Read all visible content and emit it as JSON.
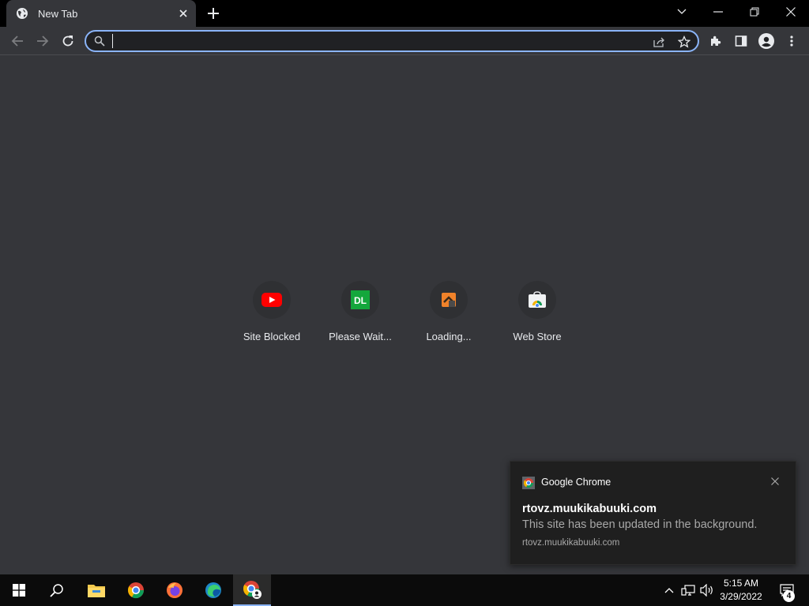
{
  "window": {
    "tab": {
      "title": "New Tab",
      "favicon": "globe-icon"
    },
    "controls": {
      "tab_search": "chevron-down-icon",
      "minimize": "minimize-icon",
      "restore": "restore-icon",
      "close": "close-icon"
    }
  },
  "toolbar": {
    "back": "arrow-left-icon",
    "forward": "arrow-right-icon",
    "reload": "reload-icon",
    "omnibox": {
      "value": "",
      "placeholder": ""
    },
    "share": "share-icon",
    "bookmark": "star-icon",
    "extensions": "puzzle-icon",
    "side_panel": "side-panel-icon",
    "profile": "profile-icon",
    "menu": "kebab-menu-icon"
  },
  "shortcuts": [
    {
      "label": "Site Blocked",
      "icon": "youtube-icon"
    },
    {
      "label": "Please Wait...",
      "icon": "dl-icon",
      "icon_text": "DL"
    },
    {
      "label": "Loading...",
      "icon": "orange-hammer-icon"
    },
    {
      "label": "Web Store",
      "icon": "chrome-web-store-icon"
    }
  ],
  "notification": {
    "app": "Google Chrome",
    "title": "rtovz.muukikabuuki.com",
    "body": "This site has been updated in the background.",
    "attribution": "rtovz.muukikabuuki.com"
  },
  "taskbar": {
    "items": [
      "windows-start-icon",
      "search-icon",
      "file-explorer-icon",
      "chrome-icon",
      "firefox-icon",
      "edge-icon",
      "chrome-profile-icon"
    ],
    "clock": {
      "time": "5:15 AM",
      "date": "3/29/2022"
    },
    "notification_count": "4"
  },
  "colors": {
    "accent": "#8ab4f8",
    "background": "#35363a",
    "titlebar": "#000000",
    "taskbar": "#0b0b0b"
  }
}
